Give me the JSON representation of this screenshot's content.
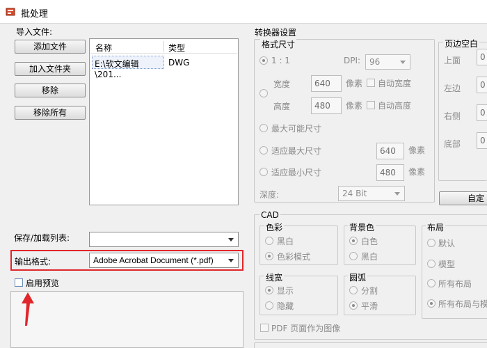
{
  "window": {
    "title": "批处理"
  },
  "left": {
    "import_label": "导入文件:",
    "buttons": {
      "add_file": "添加文件",
      "add_folder": "加入文件夹",
      "remove": "移除",
      "remove_all": "移除所有"
    },
    "list": {
      "columns": [
        "名称",
        "类型"
      ],
      "rows": [
        {
          "name": "E:\\软文编辑\\201...",
          "type": "DWG"
        }
      ]
    },
    "save_list_label": "保存/加载列表:",
    "save_list_value": "",
    "output_format_label": "输出格式:",
    "output_format_value": "Adobe Acrobat Document (*.pdf)",
    "enable_preview_label": "启用预览"
  },
  "right": {
    "converter_settings_label": "转换器设置",
    "format_size": {
      "title": "格式尺寸",
      "ratio_label": "1 : 1",
      "dpi_label": "DPI:",
      "dpi_value": "96",
      "width_label": "宽度",
      "width_value": "640",
      "height_label": "高度",
      "height_value": "480",
      "pixel_unit": "像素",
      "auto_width": "自动宽度",
      "auto_height": "自动高度",
      "max_possible": "最大可能尺寸",
      "fit_max": "适应最大尺寸",
      "fit_max_value": "640",
      "fit_min": "适应最小尺寸",
      "fit_min_value": "480",
      "depth_label": "深度:",
      "depth_value": "24 Bit"
    },
    "margins": {
      "title": "页边空白",
      "top": "上面",
      "left": "左边",
      "right": "右侧",
      "bottom": "底部",
      "top_value": "0",
      "left_value": "0",
      "right_value": "0",
      "bottom_value": "0",
      "custom_button": "自定"
    },
    "cad": {
      "title": "CAD",
      "color": {
        "title": "色彩",
        "bw": "黑白",
        "color_mode": "色彩模式"
      },
      "background": {
        "title": "背景色",
        "white": "白色",
        "black": "黑白"
      },
      "layout": {
        "title": "布局",
        "default": "默认",
        "model": "模型",
        "all_layouts": "所有布局",
        "all_layouts_and_model": "所有布局与模"
      },
      "lineweight": {
        "title": "线宽",
        "show": "显示",
        "hide": "隐藏"
      },
      "arc": {
        "title": "圆弧",
        "split": "分割",
        "smooth": "平滑"
      },
      "pdf_as_image": "PDF 页面作为图像"
    }
  }
}
